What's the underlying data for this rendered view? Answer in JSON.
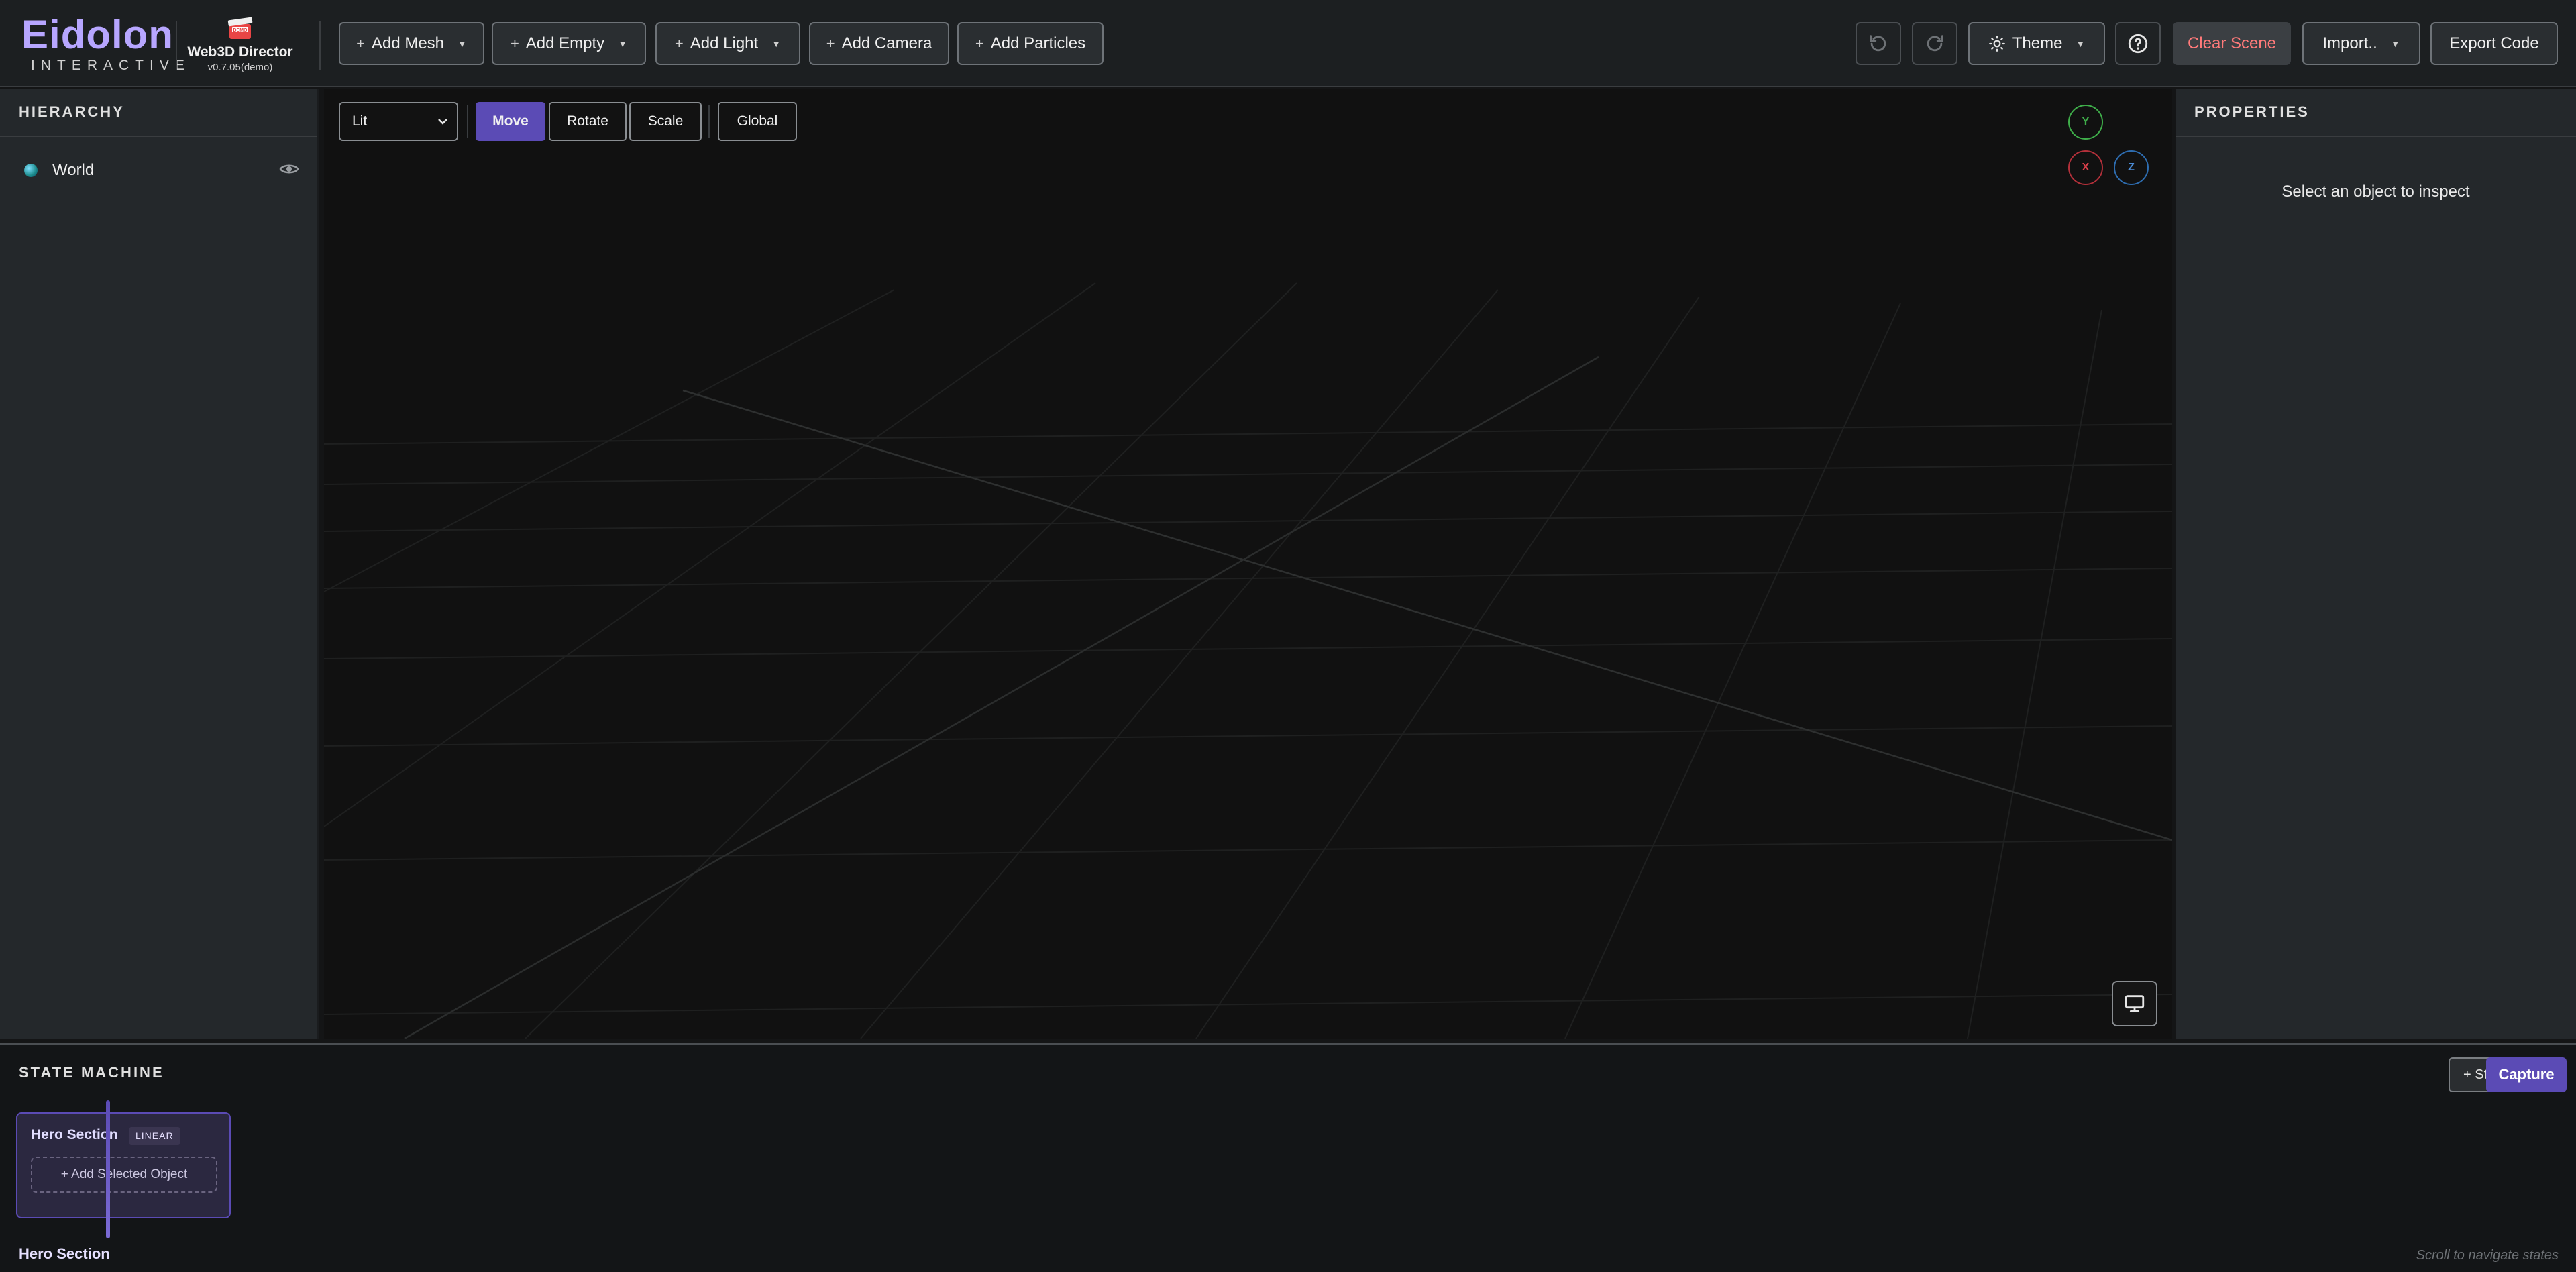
{
  "app": {
    "logo_title": "Eidolon",
    "logo_subtitle": "INTERACTIVE",
    "director_name": "Web3D Director",
    "director_version": "v0.7.05(demo)",
    "demo_badge": "DEMO",
    "accent_color": "#5b4bb5",
    "logo_color": "#b7a6ff"
  },
  "toolbar": {
    "add_mesh": "Add Mesh",
    "add_empty": "Add Empty",
    "add_light": "Add Light",
    "add_camera": "Add Camera",
    "add_particles": "Add Particles",
    "plus": "+",
    "undo_icon": "undo-icon",
    "redo_icon": "redo-icon",
    "theme": "Theme",
    "help_icon": "help-icon",
    "clear_scene": "Clear Scene",
    "import": "Import..",
    "export": "Export Code"
  },
  "hierarchy": {
    "title": "HIERARCHY",
    "items": [
      {
        "label": "World",
        "icon": "globe-icon",
        "visible": true
      }
    ]
  },
  "viewport": {
    "shading_mode": "Lit",
    "transform_modes": [
      "Move",
      "Rotate",
      "Scale"
    ],
    "active_mode": "Move",
    "space": "Global",
    "gizmo": {
      "y": "Y",
      "x": "X",
      "z": "Z"
    },
    "gizmo_colors": {
      "y": "#3fae4a",
      "x": "#b3303a",
      "z": "#2e6db0"
    }
  },
  "properties": {
    "title": "PROPERTIES",
    "empty_message": "Select an object to inspect"
  },
  "state_machine": {
    "title": "STATE MACHINE",
    "add_state": "+ State",
    "capture": "Capture",
    "states": [
      {
        "name": "Hero Section",
        "badge": "LINEAR",
        "add_object": "+ Add Selected Object"
      }
    ],
    "current_state": "Hero Section",
    "hint": "Scroll to navigate states"
  }
}
